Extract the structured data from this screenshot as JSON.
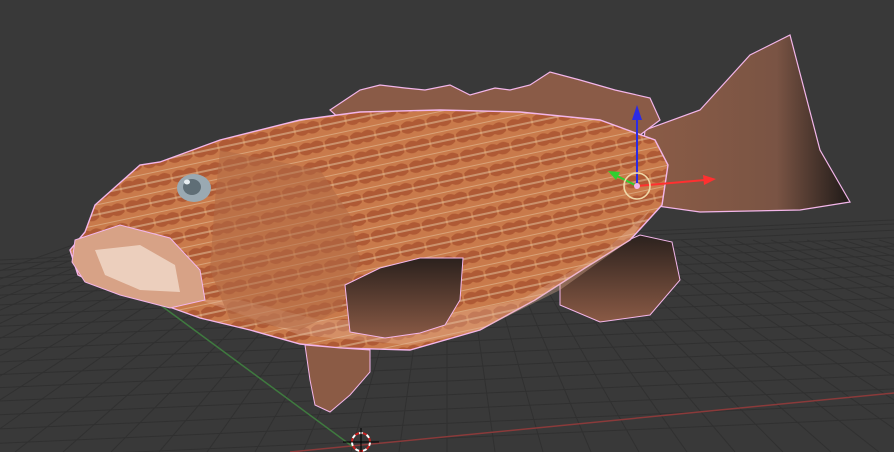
{
  "viewport": {
    "background_color": "#393939",
    "grid_color": "#2f2f2f",
    "x_axis_color": "#8a3a3a",
    "y_axis_color": "#3f7a3f"
  },
  "object": {
    "subject": "grouper fish",
    "selected": true,
    "outline_color": "#f3b6ea",
    "body_color": "#b96f4a",
    "fin_color": "#6b4a3a",
    "tail_tip_color": "#1f1a18"
  },
  "gizmo": {
    "x_axis_color": "#ff3030",
    "y_axis_color": "#2fcf2f",
    "z_axis_color": "#2b2be6",
    "pivot_color": "#f0d8a8"
  },
  "cursor": {
    "name": "3d-cursor",
    "ring_color_a": "#ffffff",
    "ring_color_b": "#cc2020"
  }
}
